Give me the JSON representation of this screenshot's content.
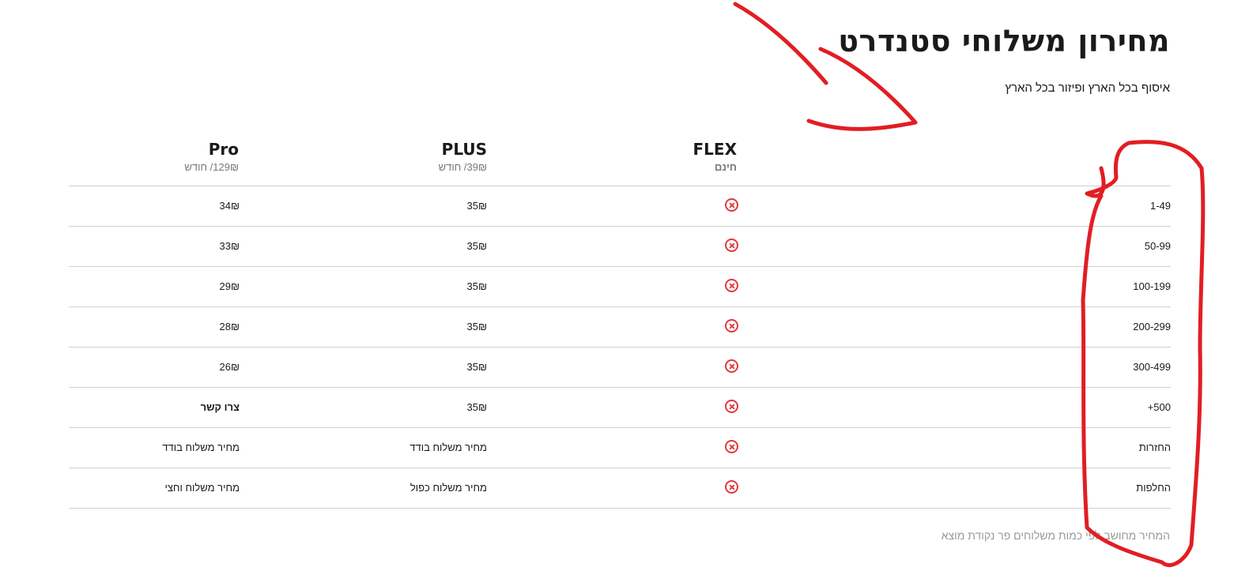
{
  "title": "מחירון משלוחי סטנדרט",
  "subtitle": "איסוף בכל הארץ ופיזור בכל הארץ",
  "plans": [
    {
      "name": "Pro",
      "price": "129₪/ חודש"
    },
    {
      "name": "PLUS",
      "price": "39₪/ חודש"
    },
    {
      "name": "FLEX",
      "price": "חינם"
    }
  ],
  "rows": [
    {
      "label": "1-49",
      "pro": "34₪",
      "plus": "35₪"
    },
    {
      "label": "50-99",
      "pro": "33₪",
      "plus": "35₪"
    },
    {
      "label": "100-199",
      "pro": "29₪",
      "plus": "35₪"
    },
    {
      "label": "200-299",
      "pro": "28₪",
      "plus": "35₪"
    },
    {
      "label": "300-499",
      "pro": "26₪",
      "plus": "35₪"
    },
    {
      "label": "500+",
      "pro": "צרו קשר",
      "plus": "35₪"
    },
    {
      "label": "החזרות",
      "pro": "מחיר משלוח בודד",
      "plus": "מחיר משלוח בודד"
    },
    {
      "label": "החלפות",
      "pro": "מחיר משלוח וחצי",
      "plus": "מחיר משלוח כפול"
    }
  ],
  "flex_icon": "x-circle-icon",
  "accent_color": "#e03a3e",
  "footnote": "המחיר מחושב לפי כמות משלוחים פר נקודת מוצא"
}
